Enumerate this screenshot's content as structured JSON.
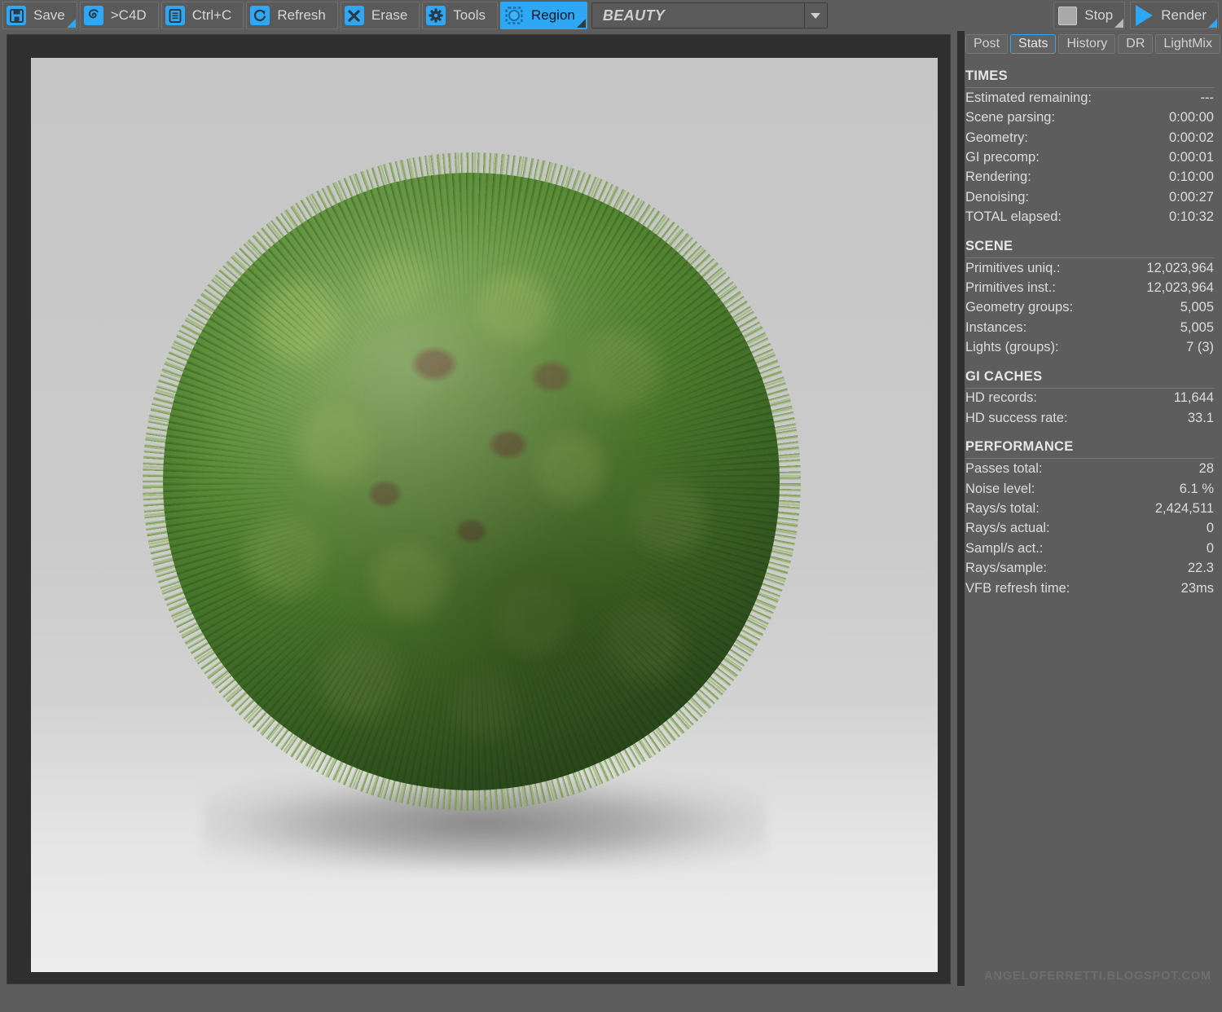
{
  "toolbar": {
    "buttons": [
      {
        "id": "save",
        "label": "Save",
        "icon": "floppy-disk-icon",
        "active": false,
        "corner": "accent"
      },
      {
        "id": "to-c4d",
        "label": ">C4D",
        "icon": "cinema4d-icon",
        "active": false,
        "corner": "none"
      },
      {
        "id": "copy",
        "label": "Ctrl+C",
        "icon": "clipboard-icon",
        "active": false,
        "corner": "none"
      },
      {
        "id": "refresh",
        "label": "Refresh",
        "icon": "refresh-icon",
        "active": false,
        "corner": "none"
      },
      {
        "id": "erase",
        "label": "Erase",
        "icon": "x-cross-icon",
        "active": false,
        "corner": "none"
      },
      {
        "id": "tools",
        "label": "Tools",
        "icon": "gear-icon",
        "active": false,
        "corner": "none"
      },
      {
        "id": "region",
        "label": "Region",
        "icon": "region-select-icon",
        "active": true,
        "corner": "dark"
      }
    ],
    "pass_selector": {
      "value": "BEAUTY",
      "placeholder": "BEAUTY"
    },
    "stop": {
      "label": "Stop",
      "icon": "stop-square-icon"
    },
    "render": {
      "label": "Render",
      "icon": "play-triangle-icon"
    }
  },
  "panel": {
    "tabs": [
      {
        "id": "post",
        "label": "Post",
        "selected": false
      },
      {
        "id": "stats",
        "label": "Stats",
        "selected": true
      },
      {
        "id": "history",
        "label": "History",
        "selected": false
      },
      {
        "id": "dr",
        "label": "DR",
        "selected": false
      },
      {
        "id": "lightmix",
        "label": "LightMix",
        "selected": false
      }
    ],
    "sections": [
      {
        "title": "TIMES",
        "rows": [
          {
            "key": "Estimated remaining:",
            "value": "---"
          },
          {
            "key": "Scene parsing:",
            "value": "0:00:00"
          },
          {
            "key": "Geometry:",
            "value": "0:00:02"
          },
          {
            "key": "GI precomp:",
            "value": "0:00:01"
          },
          {
            "key": "Rendering:",
            "value": "0:10:00"
          },
          {
            "key": "Denoising:",
            "value": "0:00:27"
          },
          {
            "key": "TOTAL elapsed:",
            "value": "0:10:32"
          }
        ]
      },
      {
        "title": "SCENE",
        "rows": [
          {
            "key": "Primitives uniq.:",
            "value": "12,023,964"
          },
          {
            "key": "Primitives inst.:",
            "value": "12,023,964"
          },
          {
            "key": "Geometry groups:",
            "value": "5,005"
          },
          {
            "key": "Instances:",
            "value": "5,005"
          },
          {
            "key": "Lights (groups):",
            "value": "7 (3)"
          }
        ]
      },
      {
        "title": "GI CACHES",
        "rows": [
          {
            "key": "HD records:",
            "value": "11,644"
          },
          {
            "key": "HD success rate:",
            "value": "33.1"
          }
        ]
      },
      {
        "title": "PERFORMANCE",
        "rows": [
          {
            "key": "Passes total:",
            "value": "28"
          },
          {
            "key": "Noise level:",
            "value": "6.1 %"
          },
          {
            "key": "Rays/s total:",
            "value": "2,424,511"
          },
          {
            "key": "Rays/s actual:",
            "value": "0"
          },
          {
            "key": "Sampl/s act.:",
            "value": "0"
          },
          {
            "key": "Rays/sample:",
            "value": "22.3"
          },
          {
            "key": "VFB refresh time:",
            "value": "23ms"
          }
        ]
      }
    ],
    "watermark": "ANGELOFERRETTI.BLOGSPOT.COM"
  },
  "viewport": {
    "content_description": "rendered grass-covered sphere on light grey backdrop with soft contact shadow"
  },
  "colors": {
    "accent": "#2ea8f5",
    "toolbar_bg": "#5d5d5d",
    "button_bg": "#5a5a5a",
    "viewport_bg": "#2f2f2f",
    "text": "#d6d6d6",
    "grass_light": "#8bb054",
    "grass_mid": "#588c33",
    "grass_dark": "#2e5420",
    "soil": "#7c5642"
  }
}
